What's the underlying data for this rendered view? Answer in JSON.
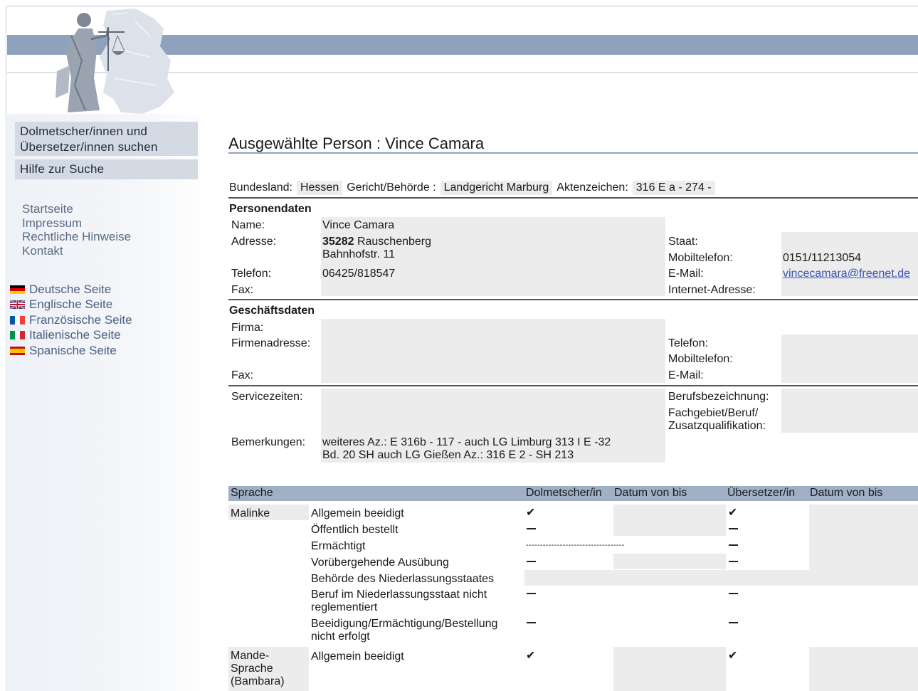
{
  "nav": {
    "search_btn": "Dolmetscher/innen und Übersetzer/innen suchen",
    "help_btn": "Hilfe zur Suche",
    "links": [
      "Startseite",
      "Impressum",
      "Rechtliche Hinweise",
      "Kontakt"
    ],
    "languages": [
      "Deutsche Seite",
      "Englische Seite",
      "Französische Seite",
      "Italienische Seite",
      "Spanische Seite"
    ]
  },
  "title": "Ausgewählte Person : Vince Camara",
  "info": {
    "bundesland_label": "Bundesland:",
    "bundesland": "Hessen",
    "gericht_label": "Gericht/Behörde :",
    "gericht": "Landgericht Marburg",
    "aktenzeichen_label": "Aktenzeichen:",
    "aktenzeichen": "316 E a - 274 -"
  },
  "person": {
    "heading": "Personendaten",
    "name_label": "Name:",
    "name": "Vince Camara",
    "address_label": "Adresse:",
    "plz": "35282",
    "city": " Rauschenberg",
    "street": "Bahnhofstr. 11",
    "phone_label": "Telefon:",
    "phone": "06425/818547",
    "fax_label": "Fax:",
    "staat_label": "Staat:",
    "mobile_label": "Mobiltelefon:",
    "mobile": "0151/11213054",
    "email_label": "E-Mail:",
    "email": "vincecamara@freenet.de",
    "web_label": "Internet-Adresse:"
  },
  "business": {
    "heading": "Geschäftsdaten",
    "firma_label": "Firma:",
    "address_label": "Firmenadresse:",
    "fax_label": "Fax:",
    "phone_label": "Telefon:",
    "mobile_label": "Mobiltelefon:",
    "email_label": "E-Mail:"
  },
  "service": {
    "times_label": "Servicezeiten:",
    "notes_label": "Bemerkungen:",
    "notes_line1": "weiteres Az.: E 316b - 117 - auch LG Limburg 313 I E -32",
    "notes_line2": "Bd. 20 SH auch LG Gießen Az.: 316 E 2 - SH 213",
    "job_label": "Berufsbezeichnung:",
    "field_label_1": "Fachgebiet/Beruf/",
    "field_label_2": "Zusatzqualifikation:"
  },
  "lang_table": {
    "headers": [
      "Sprache",
      "Dolmetscher/in",
      "Datum von bis",
      "Übersetzer/in",
      "Datum von bis"
    ],
    "lang1": "Malinke",
    "lang2": [
      "Mande-",
      "Sprache",
      "(Bambara)"
    ],
    "rows": [
      "Allgemein beeidigt",
      "Öffentlich bestellt",
      "Ermächtigt",
      "Vorübergehende Ausübung",
      "Behörde des Niederlassungsstaates",
      "Beruf im Niederlassungsstaat nicht",
      "reglementiert",
      "Beeidigung/Ermächtigung/Bestellung",
      "nicht erfolgt",
      "Allgemein beeidigt"
    ],
    "dotted": "-----------------------------------",
    "check": "✔"
  }
}
